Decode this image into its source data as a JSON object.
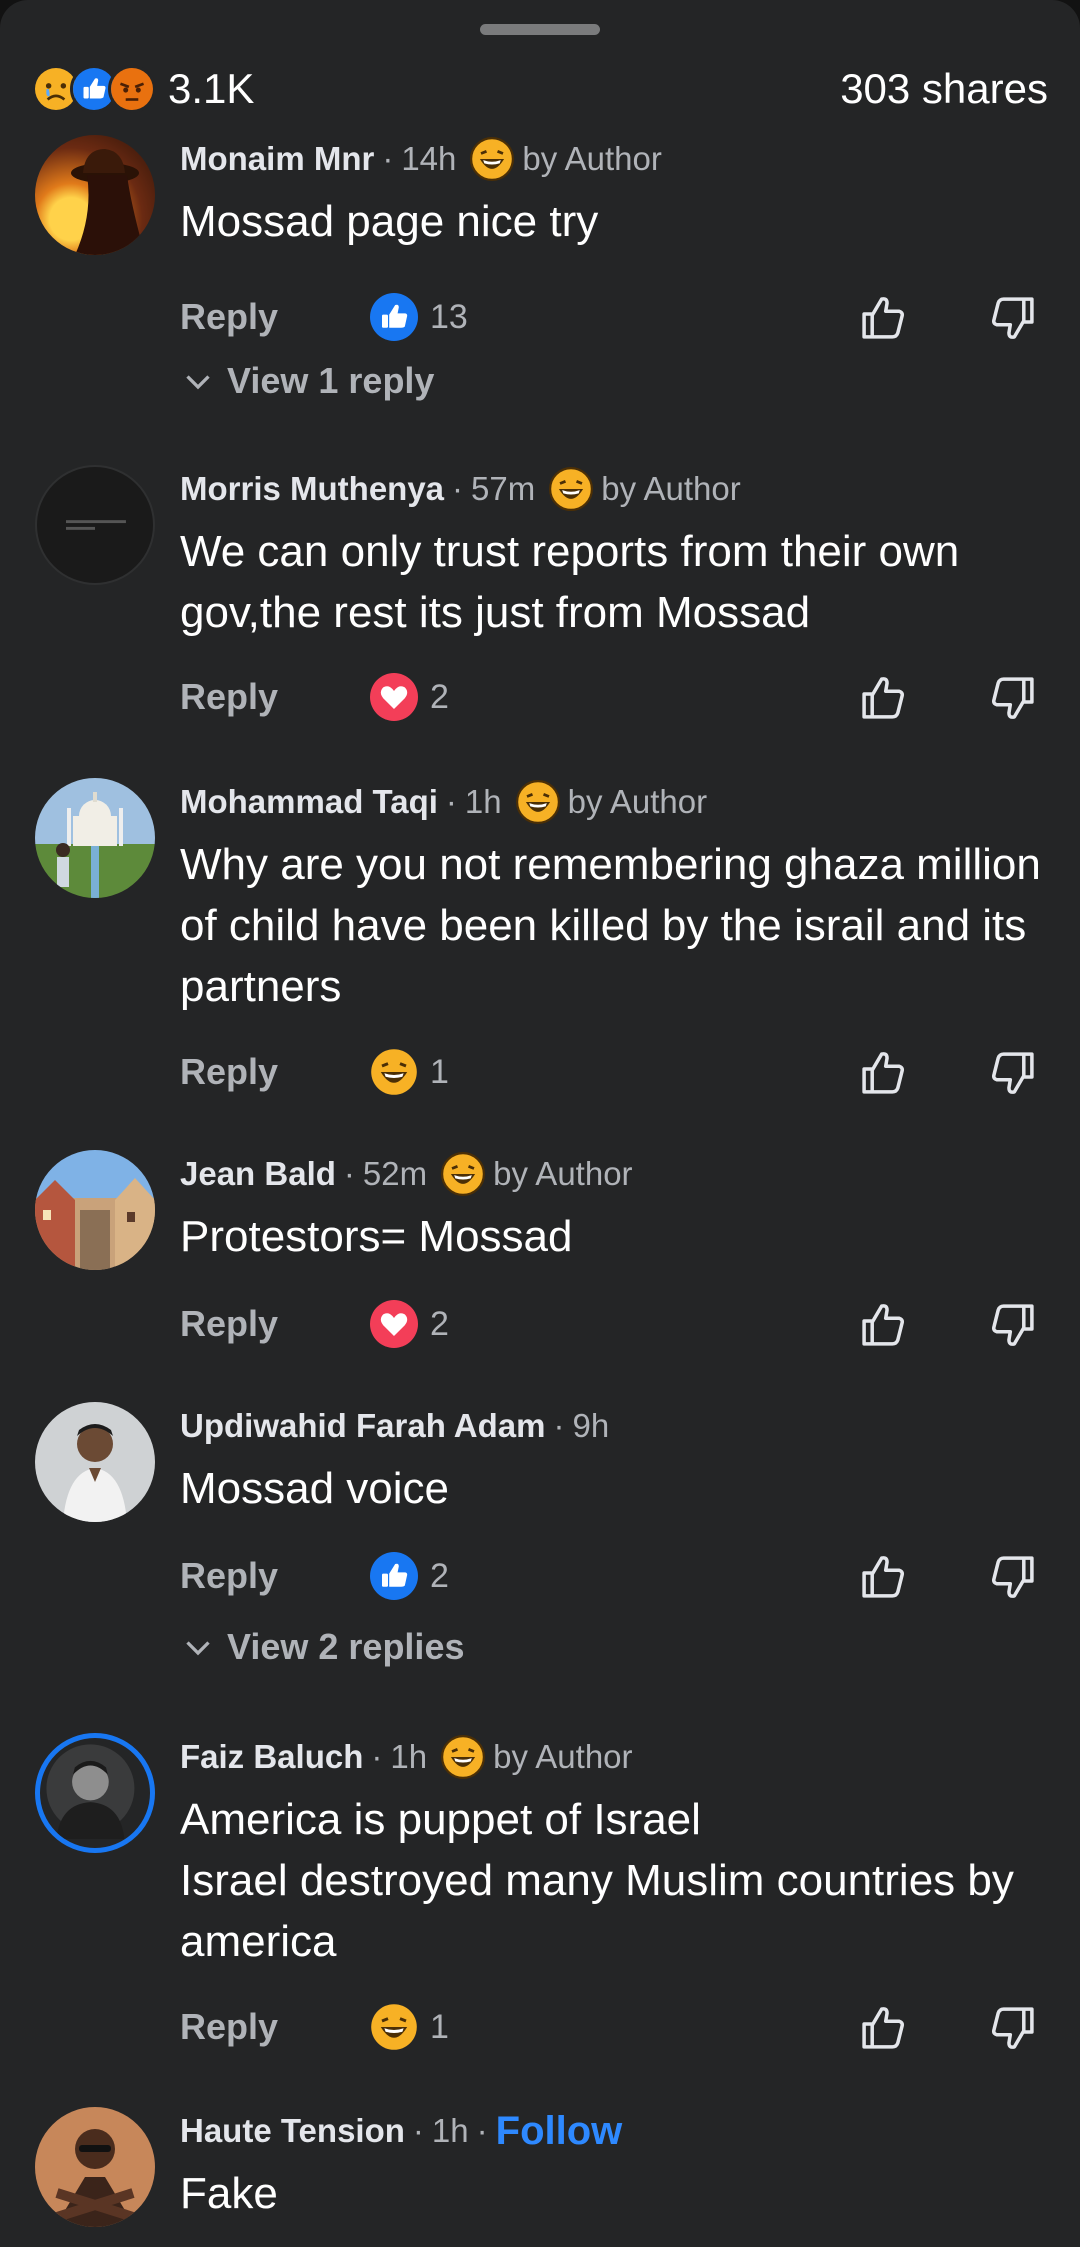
{
  "header": {
    "reaction_count": "3.1K",
    "shares": "303 shares",
    "reaction_icons": [
      "sad-icon",
      "like-icon",
      "angry-icon"
    ]
  },
  "labels": {
    "reply": "Reply",
    "by_author": "by Author"
  },
  "comments": [
    {
      "name": "Monaim Mnr",
      "time": "14h",
      "author_reacted": true,
      "text": "Mossad page nice try",
      "reaction": "like-icon",
      "reaction_count": "13",
      "view_replies": "View 1 reply"
    },
    {
      "name": "Morris Muthenya",
      "time": "57m",
      "author_reacted": true,
      "text": "We can only trust reports from their own gov,the rest its just from Mossad",
      "reaction": "love-icon",
      "reaction_count": "2"
    },
    {
      "name": "Mohammad Taqi",
      "time": "1h",
      "author_reacted": true,
      "text": "Why are you not remembering ghaza million of child have been killed by the israil and its partners",
      "reaction": "haha-icon",
      "reaction_count": "1"
    },
    {
      "name": "Jean Bald",
      "time": "52m",
      "author_reacted": true,
      "text": "Protestors= Mossad",
      "reaction": "love-icon",
      "reaction_count": "2"
    },
    {
      "name": "Updiwahid Farah Adam",
      "time": "9h",
      "author_reacted": false,
      "text": "Mossad voice",
      "reaction": "like-icon",
      "reaction_count": "2",
      "view_replies": "View 2 replies"
    },
    {
      "name": "Faiz Baluch",
      "time": "1h",
      "author_reacted": true,
      "text": "America is puppet of Israel\n Israel  destroyed many Muslim countries  by america",
      "reaction": "haha-icon",
      "reaction_count": "1"
    },
    {
      "name": "Haute Tension",
      "time": "1h",
      "follow": "Follow",
      "text": "Fake"
    }
  ],
  "colors": {
    "background": "#242526",
    "text": "#e4e6eb",
    "muted": "#b0b3b8",
    "follow": "#2e89ff",
    "like": "#1877f2",
    "love": "#f33e58",
    "haha": "#f7b125"
  }
}
